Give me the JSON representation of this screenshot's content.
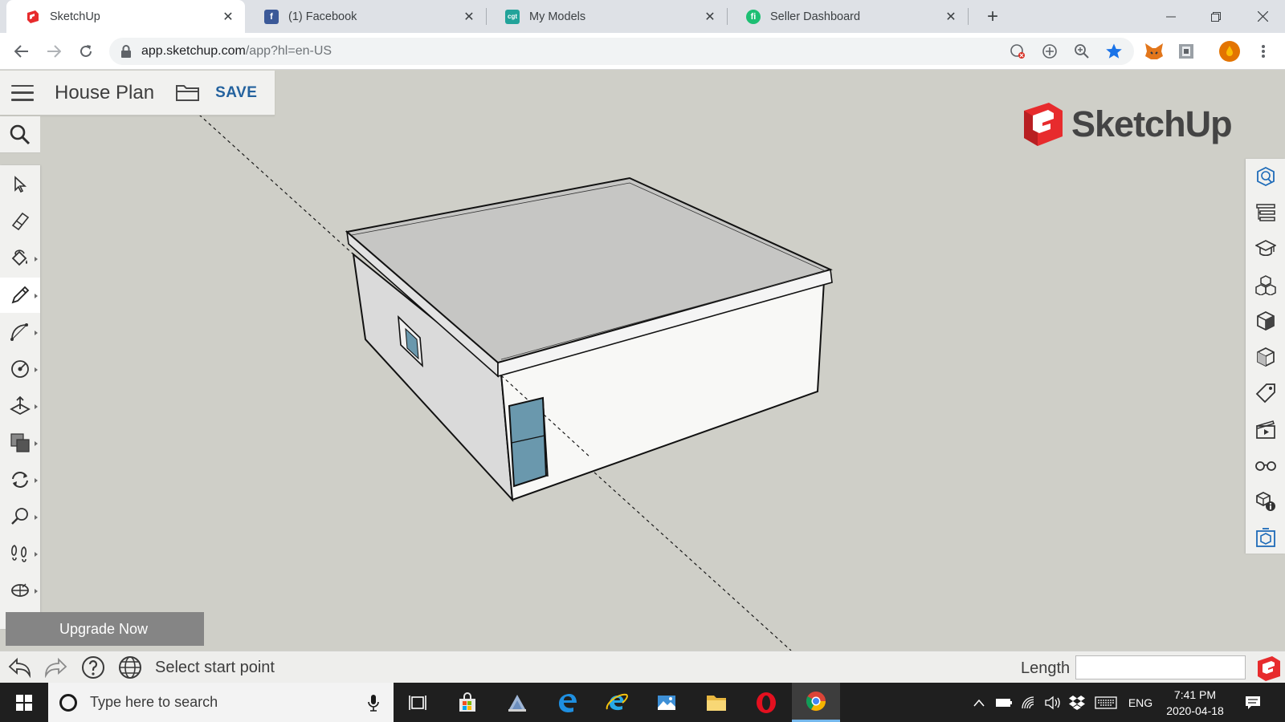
{
  "browser": {
    "tabs": [
      {
        "title": "SketchUp",
        "icon": "sketchup-favicon",
        "active": true
      },
      {
        "title": "(1) Facebook",
        "icon": "facebook-favicon",
        "active": false
      },
      {
        "title": "My Models",
        "icon": "3dwarehouse-favicon",
        "active": false
      },
      {
        "title": "Seller Dashboard",
        "icon": "fiverr-favicon",
        "active": false
      }
    ],
    "address": {
      "host": "app.sketchup.com",
      "path": "/app?hl=en-US"
    }
  },
  "sketchup": {
    "document_title": "House Plan",
    "save_label": "SAVE",
    "upgrade_label": "Upgrade Now",
    "logo_text": "SketchUp",
    "status_text": "Select start point",
    "length_label": "Length",
    "length_value": "",
    "left_tools": [
      "select",
      "eraser",
      "paint",
      "pencil",
      "arc",
      "tape-measure",
      "push-pull",
      "offset",
      "orbit",
      "walk",
      "position-camera",
      "section"
    ],
    "active_tool": "pencil",
    "right_panels": [
      "entity-info",
      "outliner",
      "instructor",
      "components",
      "materials",
      "styles",
      "tags",
      "scenes",
      "display",
      "model-info",
      "extension"
    ]
  },
  "taskbar": {
    "search_placeholder": "Type here to search",
    "language": "ENG",
    "time": "7:41 PM",
    "date": "2020-04-18"
  },
  "colors": {
    "sketchup_red": "#e72b2d",
    "save_blue": "#24629e",
    "viewport_bg": "#cfcfc8",
    "glass": "#6a98ad"
  }
}
